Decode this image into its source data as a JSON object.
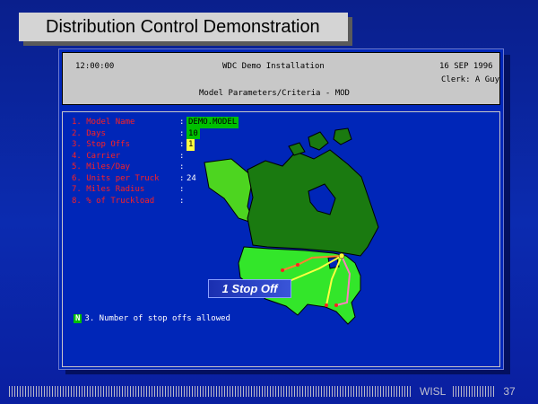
{
  "slide": {
    "title": "Distribution Control Demonstration",
    "footer_brand": "WISL",
    "page_number": "37"
  },
  "terminal": {
    "time": "12:00:00",
    "system_title": "WDC Demo Installation",
    "date": "16 SEP 1996",
    "clerk": "Clerk: A Guy",
    "screen_title": "Model Parameters/Criteria - MOD"
  },
  "params": [
    {
      "label": "1. Model Name",
      "value": "DEMO.MODEL"
    },
    {
      "label": "2. Days",
      "value": "10"
    },
    {
      "label": "3. Stop Offs",
      "value": "1"
    },
    {
      "label": "4. Carrier",
      "value": ""
    },
    {
      "label": "5. Miles/Day",
      "value": ""
    },
    {
      "label": "6. Units per Truck",
      "value": "24"
    },
    {
      "label": "7. Miles Radius",
      "value": ""
    },
    {
      "label": "8. % of Truckload",
      "value": ""
    }
  ],
  "hint": {
    "key": "N",
    "text": "3. Number of stop offs allowed"
  },
  "callout": "1 Stop Off",
  "colors": {
    "background": "#0b2bb0",
    "terminal_bg": "#0026b8",
    "canada": "#1a7a10",
    "alaska": "#4dd520",
    "usa": "#33e62a",
    "route_yellow": "#ffff40",
    "route_orange": "#ff8030",
    "route_pink": "#ff80c0",
    "field_red": "#ff2020"
  }
}
